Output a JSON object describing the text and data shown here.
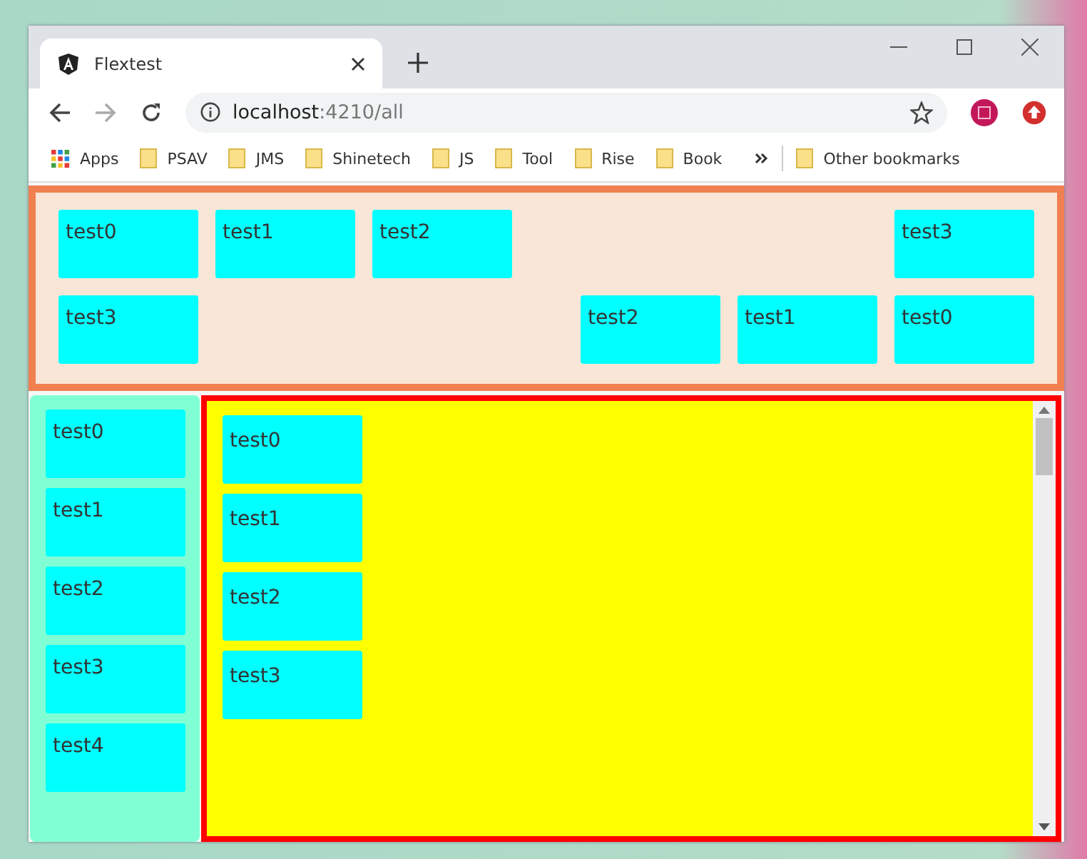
{
  "tab": {
    "title": "Flextest",
    "selected": true
  },
  "address": {
    "host": "localhost",
    "path": ":4210/all"
  },
  "bookmarks": [
    {
      "label": "Apps",
      "kind": "apps"
    },
    {
      "label": "PSAV",
      "kind": "folder"
    },
    {
      "label": "JMS",
      "kind": "folder"
    },
    {
      "label": "Shinetech",
      "kind": "folder"
    },
    {
      "label": "JS",
      "kind": "folder"
    },
    {
      "label": "Tool",
      "kind": "folder"
    },
    {
      "label": "Rise",
      "kind": "folder"
    },
    {
      "label": "Book",
      "kind": "folder"
    }
  ],
  "other_bookmarks": "Other bookmarks",
  "header_rows": [
    {
      "start_items": [
        "test0",
        "test1",
        "test2"
      ],
      "end_items": [
        "test3"
      ]
    },
    {
      "start_items": [
        "test3"
      ],
      "end_items": [
        "test2",
        "test1",
        "test0"
      ]
    }
  ],
  "sidebar_items": [
    "test0",
    "test1",
    "test2",
    "test3",
    "test4"
  ],
  "main_items": [
    "test0",
    "test1",
    "test2",
    "test3"
  ]
}
